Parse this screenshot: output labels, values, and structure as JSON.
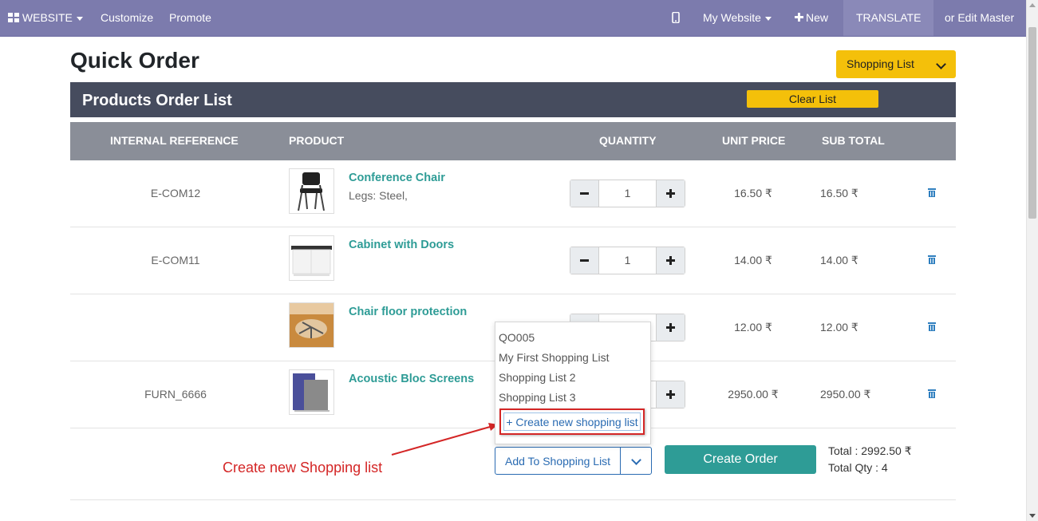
{
  "topbar": {
    "website": "WEBSITE",
    "customize": "Customize",
    "promote": "Promote",
    "my_website": "My Website",
    "new": "New",
    "translate": "TRANSLATE",
    "edit_master": "or Edit Master"
  },
  "page": {
    "title": "Quick Order",
    "shopping_list_button": "Shopping List",
    "section_title": "Products Order List",
    "clear_list": "Clear List"
  },
  "table": {
    "headers": [
      "INTERNAL REFERENCE",
      "PRODUCT",
      "QUANTITY",
      "UNIT PRICE",
      "SUB TOTAL"
    ],
    "rows": [
      {
        "ref": "E-COM12",
        "name": "Conference Chair",
        "variant": "Legs: Steel,",
        "qty": "1",
        "unit_price": "16.50 ₹",
        "subtotal": "16.50 ₹"
      },
      {
        "ref": "E-COM11",
        "name": "Cabinet with Doors",
        "variant": "",
        "qty": "1",
        "unit_price": "14.00 ₹",
        "subtotal": "14.00 ₹"
      },
      {
        "ref": "",
        "name": "Chair floor protection",
        "variant": "",
        "qty": "",
        "unit_price": "12.00 ₹",
        "subtotal": "12.00 ₹"
      },
      {
        "ref": "FURN_6666",
        "name": "Acoustic Bloc Screens",
        "variant": "",
        "qty": "",
        "unit_price": "2950.00 ₹",
        "subtotal": "2950.00 ₹"
      }
    ]
  },
  "dropdown": {
    "options": [
      "QO005",
      "My First Shopping List",
      "Shopping List 2",
      "Shopping List 3"
    ],
    "create_new": "+ Create new shopping list"
  },
  "annotation": "Create new Shopping list",
  "footer": {
    "add_to_shopping_list": "Add To Shopping List",
    "create_order": "Create Order",
    "total": "Total : 2992.50 ₹",
    "total_qty": "Total Qty : 4"
  },
  "colors": {
    "topbar": "#7c7bad",
    "accent_yellow": "#f4c00a",
    "teal": "#2e9c96",
    "annotation_red": "#d42626"
  }
}
